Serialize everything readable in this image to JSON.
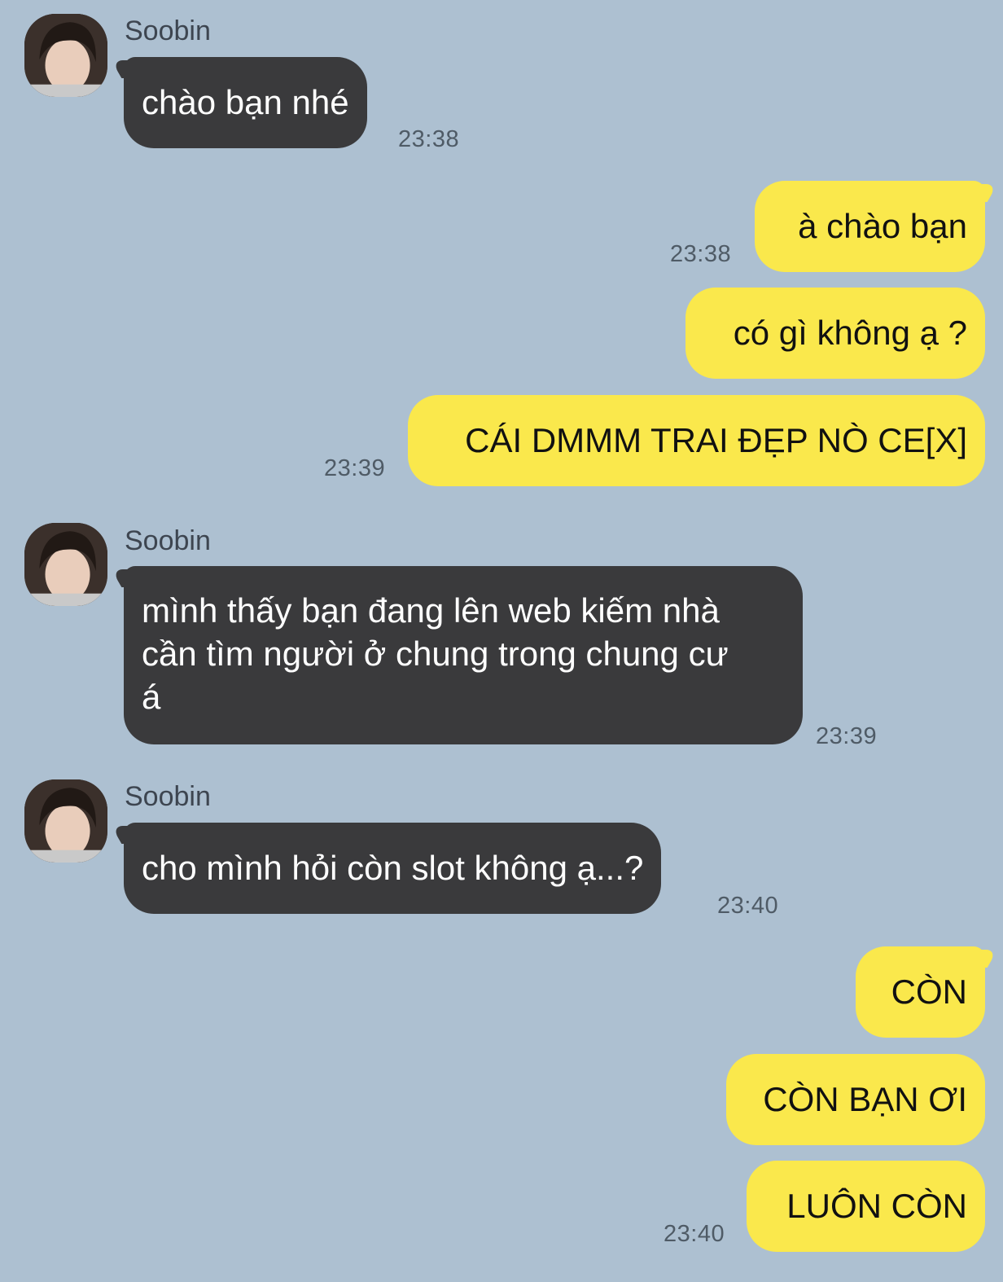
{
  "colors": {
    "background": "#adc0d1",
    "incoming_bubble": "#3a3a3c",
    "outgoing_bubble": "#fae84c"
  },
  "contact": {
    "name": "Soobin"
  },
  "messages": [
    {
      "from": "Soobin",
      "text": "chào bạn nhé",
      "time": "23:38"
    },
    {
      "from": "me",
      "text": "à chào bạn",
      "time": "23:38"
    },
    {
      "from": "me",
      "text": "có gì không ạ ?"
    },
    {
      "from": "me",
      "text": "CÁI DMMM TRAI ĐẸP NÒ CE[X]",
      "time": "23:39"
    },
    {
      "from": "Soobin",
      "text": "mình thấy bạn đang lên web kiếm nhà\ncần tìm người ở chung trong chung cư\ná",
      "time": "23:39"
    },
    {
      "from": "Soobin",
      "text": "cho mình hỏi còn slot không ạ...?",
      "time": "23:40"
    },
    {
      "from": "me",
      "text": "CÒN"
    },
    {
      "from": "me",
      "text": "CÒN BẠN ƠI"
    },
    {
      "from": "me",
      "text": "LUÔN CÒN",
      "time": "23:40"
    }
  ]
}
